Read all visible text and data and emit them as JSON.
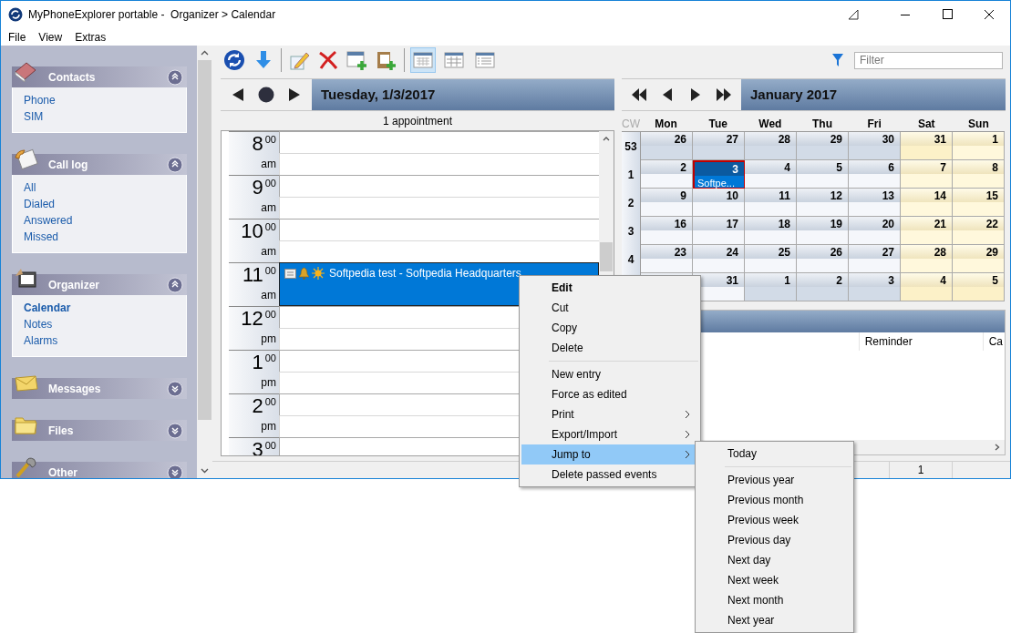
{
  "window": {
    "title": "MyPhoneExplorer portable -  Organizer > Calendar"
  },
  "menu_bar": [
    "File",
    "View",
    "Extras"
  ],
  "sidebar": {
    "groups": [
      {
        "title": "Contacts",
        "expanded": true,
        "items": [
          {
            "label": "Phone",
            "selected": false
          },
          {
            "label": "SIM",
            "selected": false
          }
        ]
      },
      {
        "title": "Call log",
        "expanded": true,
        "items": [
          {
            "label": "All",
            "selected": false
          },
          {
            "label": "Dialed",
            "selected": false
          },
          {
            "label": "Answered",
            "selected": false
          },
          {
            "label": "Missed",
            "selected": false
          }
        ]
      },
      {
        "title": "Organizer",
        "expanded": true,
        "items": [
          {
            "label": "Calendar",
            "selected": true
          },
          {
            "label": "Notes",
            "selected": false
          },
          {
            "label": "Alarms",
            "selected": false
          }
        ]
      },
      {
        "title": "Messages",
        "expanded": false
      },
      {
        "title": "Files",
        "expanded": false
      },
      {
        "title": "Other",
        "expanded": false
      }
    ]
  },
  "toolbar": {
    "actions": [
      {
        "kind": "refresh"
      },
      {
        "kind": "download"
      },
      {
        "kind": "edit"
      },
      {
        "kind": "delete"
      },
      {
        "kind": "new"
      },
      {
        "kind": "paste"
      }
    ],
    "views": [
      {
        "kind": "month",
        "selected": true
      },
      {
        "kind": "week",
        "selected": false
      },
      {
        "kind": "list",
        "selected": false
      }
    ],
    "filter": {
      "placeholder": "Filter"
    }
  },
  "day_view": {
    "date": "Tuesday, 1/3/2017",
    "summary": "1 appointment",
    "hours": [
      {
        "hour": "8",
        "minutes": "00",
        "period": "am"
      },
      {
        "hour": "9",
        "minutes": "00",
        "period": "am"
      },
      {
        "hour": "10",
        "minutes": "00",
        "period": "am"
      },
      {
        "hour": "11",
        "minutes": "00",
        "period": "am",
        "event": {
          "title": "Softpedia test - Softpedia Headquarters",
          "selected": true
        }
      },
      {
        "hour": "12",
        "minutes": "00",
        "period": "pm"
      },
      {
        "hour": "1",
        "minutes": "00",
        "period": "pm"
      },
      {
        "hour": "2",
        "minutes": "00",
        "period": "pm"
      },
      {
        "hour": "3",
        "minutes": "00"
      }
    ]
  },
  "month_view": {
    "title": "January 2017",
    "cw_label": "CW",
    "weekdays": [
      "Mon",
      "Tue",
      "Wed",
      "Thu",
      "Fri",
      "Sat",
      "Sun"
    ],
    "weeks": [
      {
        "cw": "53",
        "days": [
          {
            "day": "26",
            "in_month": false,
            "selected": false
          },
          {
            "day": "27",
            "in_month": false,
            "selected": false
          },
          {
            "day": "28",
            "in_month": false,
            "selected": false
          },
          {
            "day": "29",
            "in_month": false,
            "selected": false
          },
          {
            "day": "30",
            "in_month": false,
            "selected": false
          },
          {
            "day": "31",
            "in_month": false,
            "selected": false
          },
          {
            "day": "1",
            "in_month": true,
            "selected": false
          }
        ]
      },
      {
        "cw": "1",
        "days": [
          {
            "day": "2",
            "in_month": true,
            "selected": false
          },
          {
            "day": "3",
            "in_month": true,
            "selected": true,
            "event": "Softpe..."
          },
          {
            "day": "4",
            "in_month": true,
            "selected": false
          },
          {
            "day": "5",
            "in_month": true,
            "selected": false
          },
          {
            "day": "6",
            "in_month": true,
            "selected": false
          },
          {
            "day": "7",
            "in_month": true,
            "selected": false
          },
          {
            "day": "8",
            "in_month": true,
            "selected": false
          }
        ]
      },
      {
        "cw": "2",
        "days": [
          {
            "day": "9",
            "in_month": true,
            "selected": false
          },
          {
            "day": "10",
            "in_month": true,
            "selected": false
          },
          {
            "day": "11",
            "in_month": true,
            "selected": false
          },
          {
            "day": "12",
            "in_month": true,
            "selected": false
          },
          {
            "day": "13",
            "in_month": true,
            "selected": false
          },
          {
            "day": "14",
            "in_month": true,
            "selected": false
          },
          {
            "day": "15",
            "in_month": true,
            "selected": false
          }
        ]
      },
      {
        "cw": "3",
        "days": [
          {
            "day": "16",
            "in_month": true,
            "selected": false
          },
          {
            "day": "17",
            "in_month": true,
            "selected": false
          },
          {
            "day": "18",
            "in_month": true,
            "selected": false
          },
          {
            "day": "19",
            "in_month": true,
            "selected": false
          },
          {
            "day": "20",
            "in_month": true,
            "selected": false
          },
          {
            "day": "21",
            "in_month": true,
            "selected": false
          },
          {
            "day": "22",
            "in_month": true,
            "selected": false
          }
        ]
      },
      {
        "cw": "4",
        "days": [
          {
            "day": "23",
            "in_month": true,
            "selected": false
          },
          {
            "day": "24",
            "in_month": true,
            "selected": false
          },
          {
            "day": "25",
            "in_month": true,
            "selected": false
          },
          {
            "day": "26",
            "in_month": true,
            "selected": false
          },
          {
            "day": "27",
            "in_month": true,
            "selected": false
          },
          {
            "day": "28",
            "in_month": true,
            "selected": false
          },
          {
            "day": "29",
            "in_month": true,
            "selected": false
          }
        ]
      },
      {
        "days": [
          {
            "selected": false
          },
          {
            "day": "31",
            "in_month": true,
            "selected": false
          },
          {
            "day": "1",
            "in_month": false,
            "selected": false
          },
          {
            "day": "2",
            "in_month": false,
            "selected": false
          },
          {
            "day": "3",
            "in_month": false,
            "selected": false
          },
          {
            "day": "4",
            "in_month": false,
            "selected": false
          },
          {
            "day": "5",
            "in_month": false,
            "selected": false
          }
        ]
      }
    ]
  },
  "events_list": {
    "columns": [
      {
        "label": "Reminder"
      },
      {
        "label": "Ca"
      }
    ]
  },
  "status_bar": {
    "count": "1"
  },
  "context_menu": {
    "items": [
      {
        "kind": "item",
        "label": "Edit",
        "default": true,
        "submenu": false,
        "selected": false
      },
      {
        "kind": "item",
        "label": "Cut",
        "default": false,
        "submenu": false,
        "selected": false
      },
      {
        "kind": "item",
        "label": "Copy",
        "default": false,
        "submenu": false,
        "selected": false
      },
      {
        "kind": "item",
        "label": "Delete",
        "default": false,
        "submenu": false,
        "selected": false
      },
      {
        "kind": "separator"
      },
      {
        "kind": "item",
        "label": "New entry",
        "default": false,
        "submenu": false,
        "selected": false
      },
      {
        "kind": "item",
        "label": "Force as edited",
        "default": false,
        "submenu": false,
        "selected": false
      },
      {
        "kind": "item",
        "label": "Print",
        "default": false,
        "submenu": true,
        "selected": false
      },
      {
        "kind": "item",
        "label": "Export/Import",
        "default": false,
        "submenu": true,
        "selected": false
      },
      {
        "kind": "item",
        "label": "Jump to",
        "default": false,
        "submenu": true,
        "selected": true
      },
      {
        "kind": "item",
        "label": "Delete passed events",
        "default": false,
        "submenu": false,
        "selected": false
      }
    ]
  },
  "submenu": {
    "items": [
      {
        "kind": "item",
        "label": "Today",
        "selected": false
      },
      {
        "kind": "separator"
      },
      {
        "kind": "item",
        "label": "Previous year",
        "selected": false
      },
      {
        "kind": "item",
        "label": "Previous month",
        "selected": false
      },
      {
        "kind": "item",
        "label": "Previous week",
        "selected": false
      },
      {
        "kind": "item",
        "label": "Previous day",
        "selected": false
      },
      {
        "kind": "item",
        "label": "Next day",
        "selected": false
      },
      {
        "kind": "item",
        "label": "Next week",
        "selected": false
      },
      {
        "kind": "item",
        "label": "Next month",
        "selected": false
      },
      {
        "kind": "item",
        "label": "Next year",
        "selected": false
      }
    ]
  }
}
